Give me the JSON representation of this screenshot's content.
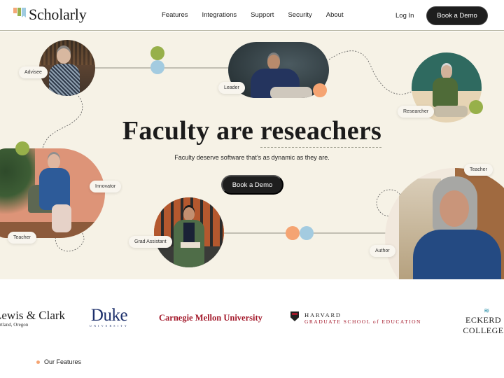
{
  "brand": {
    "name": "Scholarly",
    "colors": {
      "orange": "#f5a472",
      "green": "#97b04a",
      "blue": "#a3cbe0",
      "cream": "#f6f2e6",
      "dark": "#1e1e1e"
    }
  },
  "nav": {
    "links": [
      "Features",
      "Integrations",
      "Support",
      "Security",
      "About"
    ],
    "login": "Log In",
    "cta": "Book a Demo"
  },
  "hero": {
    "headline_part1": "Faculty are ",
    "headline_part2": "reseachers",
    "subline": "Faculty deserve software that’s as dynamic as they are.",
    "cta": "Book a Demo",
    "tags": {
      "advisee": "Advisee",
      "leader": "Leader",
      "researcher": "Researcher",
      "innovator": "Innovator",
      "teacher_left": "Teacher",
      "grad_assistant": "Grad Assistant",
      "teacher_right": "Teacher",
      "author": "Author"
    }
  },
  "logos": {
    "lewis_clark": {
      "name": "Lewis & Clark",
      "sub": "Portland, Oregon"
    },
    "duke": {
      "name": "Duke",
      "sub": "UNIVERSITY"
    },
    "cmu": "Carnegie Mellon University",
    "harvard": {
      "line1": "HARVARD",
      "line2": "GRADUATE SCHOOL of EDUCATION"
    },
    "eckerd": {
      "name": "ECKERD COLLEGE"
    }
  },
  "section": {
    "label": "Our Features"
  }
}
